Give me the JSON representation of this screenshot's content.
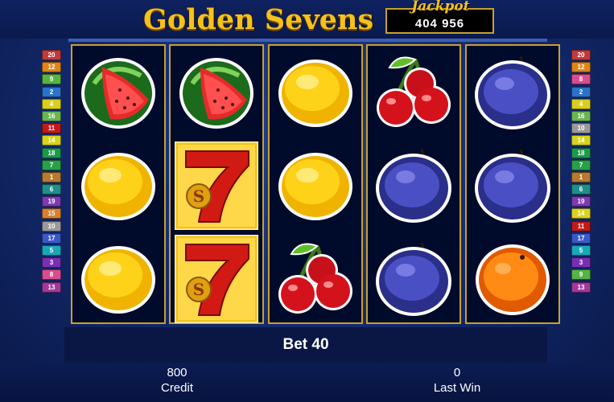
{
  "game": {
    "title": "Golden Sevens",
    "jackpot_label": "Jackpot",
    "jackpot_value": "404 956"
  },
  "paylines": {
    "left": [
      "20",
      "12",
      "9",
      "2",
      "4",
      "16",
      "11",
      "14",
      "18",
      "7",
      "1",
      "6",
      "19",
      "15",
      "10",
      "17",
      "5",
      "3",
      "8",
      "13"
    ],
    "right": [
      "20",
      "12",
      "8",
      "2",
      "4",
      "16",
      "10",
      "14",
      "18",
      "7",
      "1",
      "6",
      "19",
      "14",
      "11",
      "17",
      "5",
      "3",
      "9",
      "13"
    ],
    "colors": [
      "#b77a2d",
      "#2b73c9",
      "#7a2fb2",
      "#d8cf1e",
      "#1aa7b9",
      "#1e8f8a",
      "#27a04a",
      "#d84d8e",
      "#56b442",
      "#9a9a9a",
      "#c21a1a",
      "#e08417",
      "#a2389b",
      "#d7d220",
      "#d88030",
      "#6ab552",
      "#3a59c9",
      "#1b9a4b",
      "#7d3ab4",
      "#bf3a3a"
    ]
  },
  "reels": [
    [
      "watermelon-icon",
      "lemon-icon",
      "lemon-icon"
    ],
    [
      "watermelon-icon",
      "seven-icon",
      "seven-icon"
    ],
    [
      "lemon-icon",
      "lemon-icon",
      "cherries-icon"
    ],
    [
      "cherries-icon",
      "plum-icon",
      "plum-icon"
    ],
    [
      "plum-icon",
      "plum-icon",
      "orange-icon"
    ]
  ],
  "bet": {
    "label": "Bet 40"
  },
  "credit": {
    "value": "800",
    "label": "Credit"
  },
  "last_win": {
    "value": "0",
    "label": "Last Win"
  }
}
